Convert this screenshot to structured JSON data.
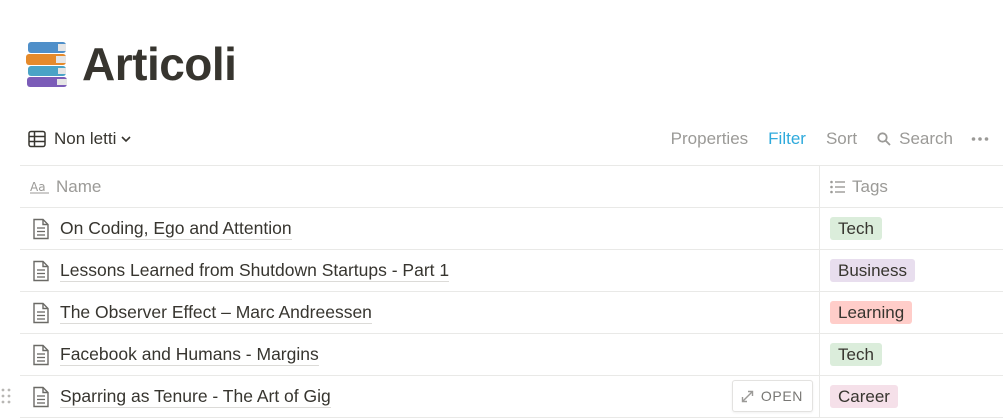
{
  "page": {
    "title": "Articoli",
    "icon": "books-icon"
  },
  "toolbar": {
    "view_label": "Non letti",
    "properties": "Properties",
    "filter": "Filter",
    "sort": "Sort",
    "search": "Search"
  },
  "table": {
    "columns": {
      "name": "Name",
      "tags": "Tags"
    },
    "rows": [
      {
        "name": "On Coding, Ego and Attention",
        "tag": "Tech",
        "tag_color": "#dbeddb"
      },
      {
        "name": "Lessons Learned from Shutdown Startups - Part 1",
        "tag": "Business",
        "tag_color": "#e8deee"
      },
      {
        "name": "The Observer Effect – Marc Andreessen",
        "tag": "Learning",
        "tag_color": "#ffcdc9"
      },
      {
        "name": "Facebook and Humans - Margins",
        "tag": "Tech",
        "tag_color": "#dbeddb"
      },
      {
        "name": "Sparring as Tenure - The Art of Gig",
        "tag": "Career",
        "tag_color": "#f5e0e9"
      }
    ],
    "open_label": "OPEN"
  }
}
